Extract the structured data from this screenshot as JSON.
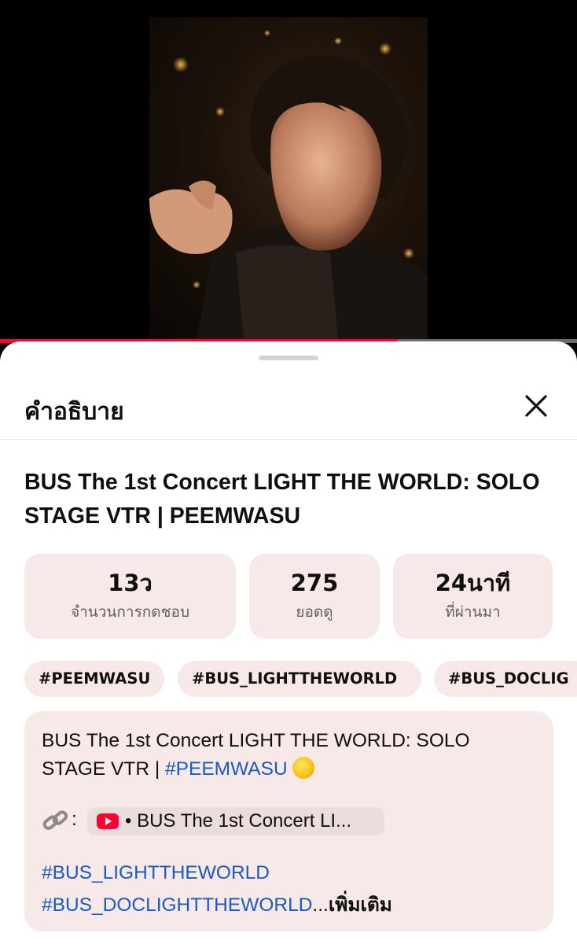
{
  "player": {
    "progress_fraction": 0.69
  },
  "sheet": {
    "title": "คำอธิบาย",
    "video_title": "BUS The 1st Concert LIGHT THE WORLD: SOLO STAGE VTR | PEEMWASU"
  },
  "stats": [
    {
      "value": "13",
      "value_suffix": "ว",
      "label": "จำนวนการกดชอบ"
    },
    {
      "value": "275",
      "label": "ยอดดู"
    },
    {
      "value": "24นาที",
      "label": "ที่ผ่านมา"
    }
  ],
  "tags": [
    "#PEEMWASU",
    "#BUS_LIGHTTHEWORLD",
    "#BUS_DOCLIG"
  ],
  "description": {
    "line1": "BUS The 1st Concert LIGHT THE WORLD: SOLO",
    "line2_prefix": "STAGE VTR | ",
    "line2_hashtag": "#PEEMWASU",
    "link_colon": ":",
    "link_chip_text": "• BUS The 1st Concert LI...",
    "hashtag1": "#BUS_LIGHTTHEWORLD",
    "hashtag2": "#BUS_DOCLIGHTTHEWORLD",
    "ellipsis": "...",
    "more_label": "เพิ่มเติม"
  },
  "colors": {
    "accent_red": "#ff0033",
    "hashtag_blue": "#1a59c8",
    "chip_bg": "#f7e9e8"
  },
  "icons": {
    "close": "close-icon",
    "link": "link-icon",
    "youtube": "youtube-icon",
    "moon": "full-moon-emoji"
  }
}
